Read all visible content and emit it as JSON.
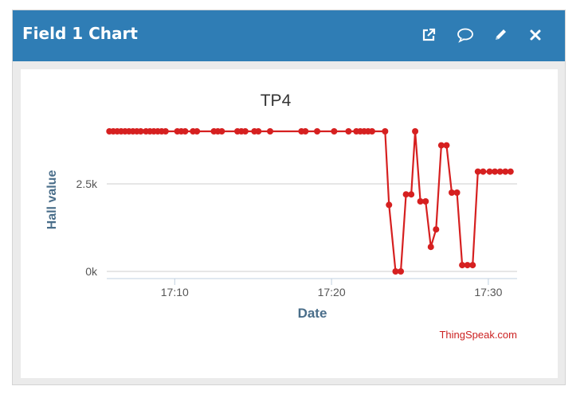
{
  "widget": {
    "title": "Field 1 Chart",
    "actions": [
      {
        "name": "open-external-icon"
      },
      {
        "name": "comment-icon"
      },
      {
        "name": "edit-icon"
      },
      {
        "name": "close-icon"
      }
    ]
  },
  "credit": "ThingSpeak.com",
  "colors": {
    "header": "#2f7db5",
    "series": "#d62020",
    "axis_title": "#4a6e8a",
    "credit": "#cc2222"
  },
  "chart_data": {
    "type": "line",
    "title": "TP4",
    "xlabel": "Date",
    "ylabel": "Hall value",
    "x_ticks": [
      "17:10",
      "17:20",
      "17:30"
    ],
    "y_ticks": [
      "0k",
      "2.5k"
    ],
    "ylim": [
      -250,
      4500
    ],
    "xlim": [
      "17:05:40",
      "17:31:50"
    ],
    "grid": true,
    "legend": "none",
    "series": [
      {
        "x": [
          "17:05:50",
          "17:06:05",
          "17:06:20",
          "17:06:35",
          "17:06:50",
          "17:07:05",
          "17:07:20",
          "17:07:35",
          "17:07:50",
          "17:08:10",
          "17:08:25",
          "17:08:40",
          "17:08:55",
          "17:09:10",
          "17:09:25",
          "17:10:10",
          "17:10:25",
          "17:10:40",
          "17:11:10",
          "17:11:25",
          "17:12:30",
          "17:12:45",
          "17:13:00",
          "17:14:00",
          "17:14:15",
          "17:14:30",
          "17:15:05",
          "17:15:20",
          "17:16:05",
          "17:18:05",
          "17:18:20",
          "17:19:05",
          "17:20:10",
          "17:21:05",
          "17:21:35",
          "17:21:50",
          "17:22:05",
          "17:22:20",
          "17:22:35",
          "17:23:25",
          "17:23:40",
          "17:24:05",
          "17:24:25",
          "17:24:45",
          "17:25:05",
          "17:25:20",
          "17:25:40",
          "17:26:00",
          "17:26:20",
          "17:26:40",
          "17:27:00",
          "17:27:20",
          "17:27:40",
          "17:28:00",
          "17:28:20",
          "17:28:40",
          "17:29:00",
          "17:29:20",
          "17:29:40",
          "17:30:05",
          "17:30:25",
          "17:30:45",
          "17:31:05",
          "17:31:25"
        ],
        "y": [
          4000,
          4000,
          4000,
          4000,
          4000,
          4000,
          4000,
          4000,
          4000,
          4000,
          4000,
          4000,
          4000,
          4000,
          4000,
          4000,
          4000,
          4000,
          4000,
          4000,
          4000,
          4000,
          4000,
          4000,
          4000,
          4000,
          4000,
          4000,
          4000,
          4000,
          4000,
          4000,
          4000,
          4000,
          4000,
          4000,
          4000,
          4000,
          4000,
          4000,
          1900,
          0,
          0,
          2200,
          2200,
          4000,
          2000,
          2000,
          700,
          1200,
          3600,
          3600,
          2250,
          2250,
          180,
          180,
          180,
          2850,
          2850,
          2850,
          2850,
          2850,
          2850,
          2850
        ]
      }
    ]
  }
}
